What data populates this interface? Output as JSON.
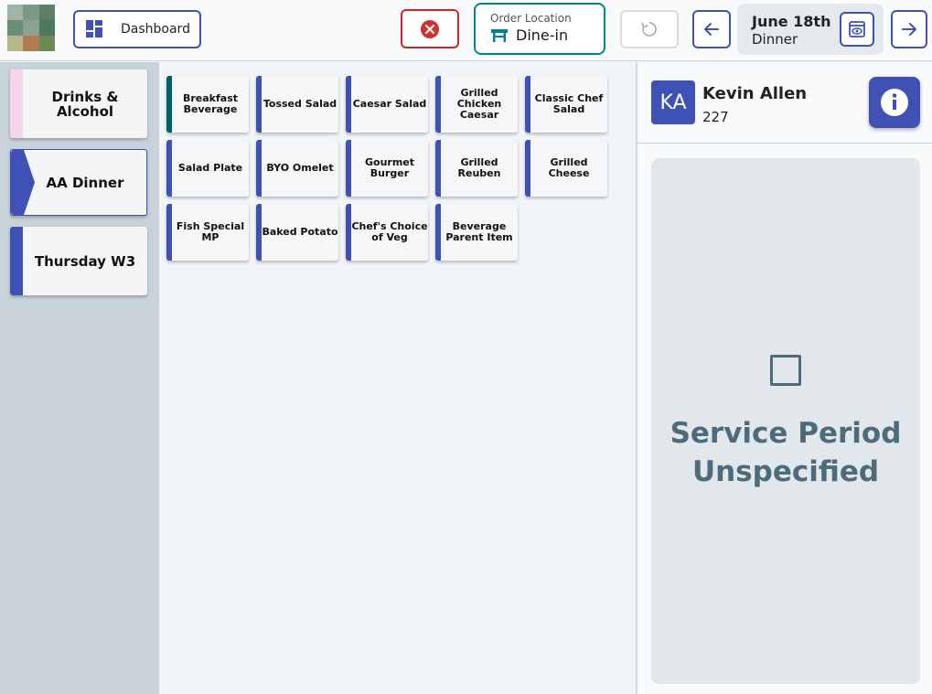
{
  "header": {
    "logo_colors": [
      "#9fb3a8",
      "#7d9886",
      "#5d7f67",
      "#6a8f78",
      "#8aa291",
      "#4d7a5f",
      "#b7b58a",
      "#b07a52",
      "#6d8a58"
    ],
    "dashboard_label": "Dashboard",
    "dashboard_icon": "dashboard-grid-icon",
    "cancel_icon": "close-circle-icon",
    "location_caption": "Order Location",
    "location_value": "Dine-in",
    "location_icon": "table-icon",
    "refresh_icon": "refresh-icon",
    "date": "June 18th",
    "meal": "Dinner"
  },
  "sidebar": {
    "categories": [
      {
        "label": "Drinks & Alcohol",
        "color": "#f6d4ea"
      },
      {
        "label": "AA Dinner",
        "color": "#3f51b5",
        "active": true
      },
      {
        "label": "Thursday W3",
        "color": "#3f51b5"
      }
    ]
  },
  "menu_items": [
    {
      "label": "Breakfast Beverage",
      "color": "#00606b"
    },
    {
      "label": "Tossed Salad",
      "color": "#3f51b5"
    },
    {
      "label": "Caesar Salad",
      "color": "#3f51b5"
    },
    {
      "label": "Grilled Chicken Caesar",
      "color": "#3f51b5"
    },
    {
      "label": "Classic Chef Salad",
      "color": "#3f51b5"
    },
    {
      "label": "Salad Plate",
      "color": "#3f51b5"
    },
    {
      "label": "BYO Omelet",
      "color": "#3f51b5"
    },
    {
      "label": "Gourmet Burger",
      "color": "#3f51b5"
    },
    {
      "label": "Grilled Reuben",
      "color": "#3f51b5"
    },
    {
      "label": "Grilled Cheese",
      "color": "#3f51b5"
    },
    {
      "label": "Fish Special MP",
      "color": "#3f51b5"
    },
    {
      "label": "Baked Potato",
      "color": "#3f51b5"
    },
    {
      "label": "Chef's Choice of Veg",
      "color": "#3f51b5"
    },
    {
      "label": "Beverage Parent Item",
      "color": "#3f51b5"
    }
  ],
  "customer": {
    "initials": "KA",
    "name": "Kevin Allen",
    "id": "227"
  },
  "service": {
    "message": "Service Period Unspecified"
  }
}
